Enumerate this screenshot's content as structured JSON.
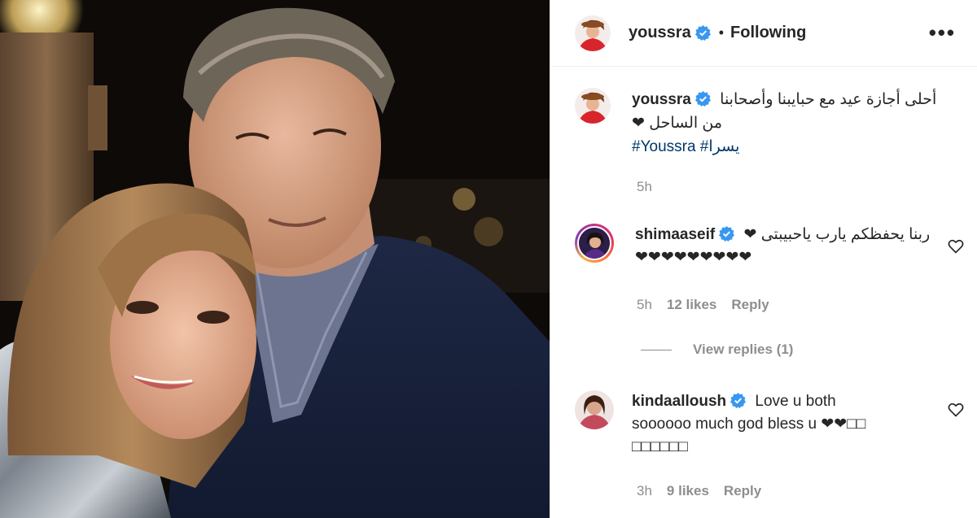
{
  "post": {
    "author": "youssra",
    "status": "Following",
    "more_label": "•••"
  },
  "caption": {
    "author": "youssra",
    "line1": "أحلى أجازة عيد مع حبايبنا وأصحابنا",
    "line2": "من الساحل ❤",
    "hashtags": "#Youssra #يسرا",
    "time": "5h"
  },
  "comments": [
    {
      "author": "shimaaseif",
      "text_line1": "ربنا يحفظكم يارب ياحبيبتى ❤",
      "text_line2": "❤❤❤❤❤❤❤❤❤",
      "time": "5h",
      "likes": "12 likes",
      "reply": "Reply",
      "view_replies": "View replies (1)"
    },
    {
      "author": "kindaalloush",
      "text_line1": "Love u both",
      "text_line2": "soooooo much god bless u ❤❤□□",
      "text_line3": "□□□□□□",
      "time": "3h",
      "likes": "9 likes",
      "reply": "Reply"
    }
  ],
  "colors": {
    "verified": "#3897f0",
    "link": "#00376b",
    "muted": "#8e8e8e",
    "photo_bg": "#0d0a08"
  },
  "icons": [
    "verified-badge-icon",
    "more-options-icon",
    "heart-outline-icon"
  ]
}
